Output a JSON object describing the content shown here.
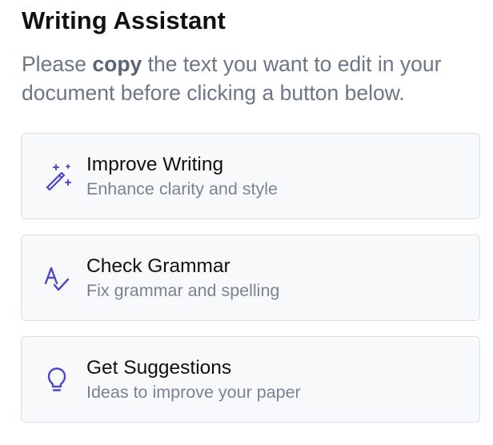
{
  "header": {
    "title": "Writing Assistant",
    "instruction_prefix": "Please ",
    "instruction_bold": "copy",
    "instruction_suffix": " the text you want to edit in your document before clicking a button below."
  },
  "actions": [
    {
      "icon": "magic-wand-icon",
      "title": "Improve Writing",
      "subtitle": "Enhance clarity and style"
    },
    {
      "icon": "spell-check-icon",
      "title": "Check Grammar",
      "subtitle": "Fix grammar and spelling"
    },
    {
      "icon": "lightbulb-icon",
      "title": "Get Suggestions",
      "subtitle": "Ideas to improve your paper"
    }
  ],
  "colors": {
    "accent": "#4f46c8",
    "card_background": "#f8f9fb",
    "card_border": "#dcdfe4",
    "muted_text": "#6b7687"
  }
}
